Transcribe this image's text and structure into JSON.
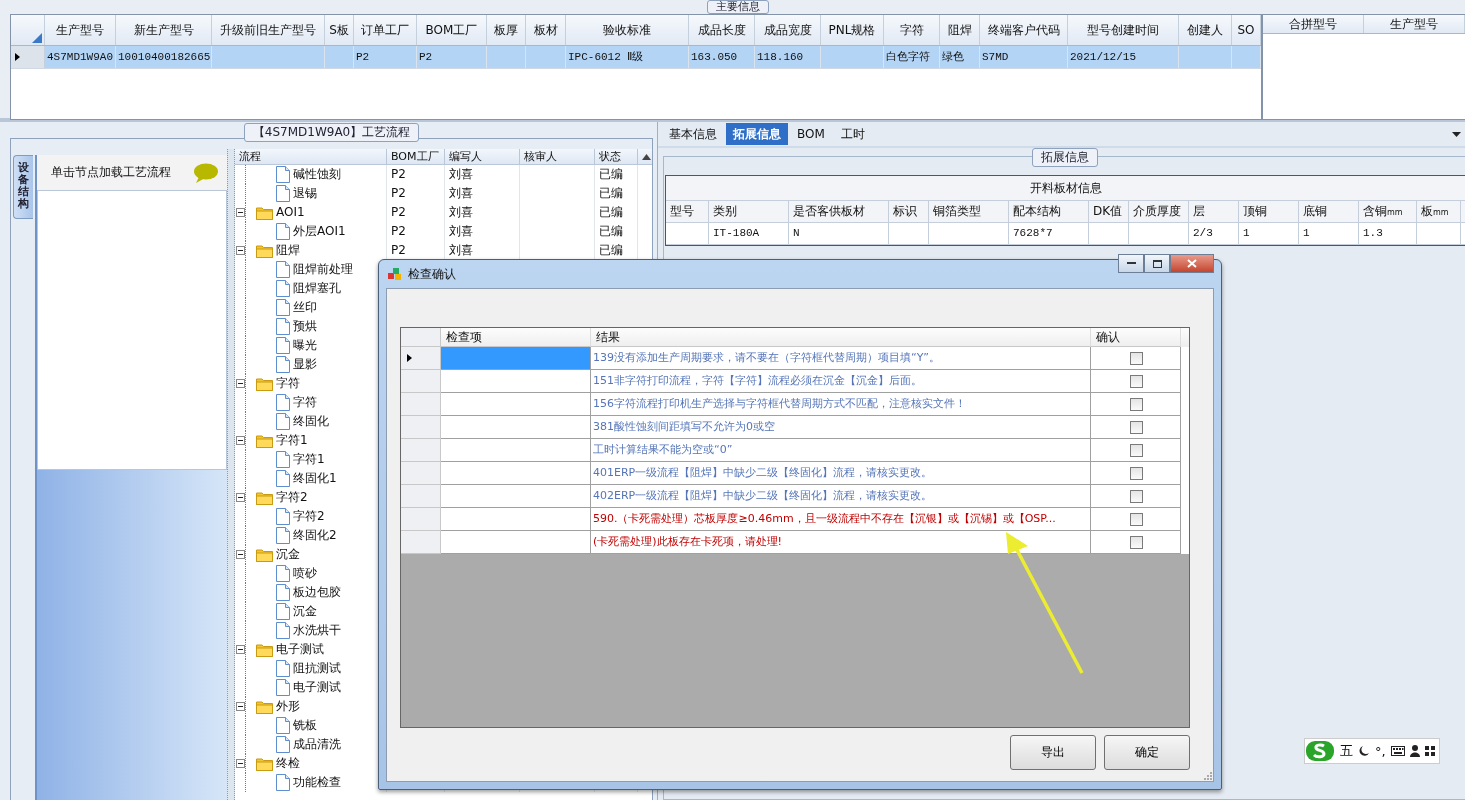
{
  "main_info": {
    "title": "主要信息",
    "columns": [
      "生产型号",
      "新生产型号",
      "升级前旧生产型号",
      "S板",
      "订单工厂",
      "BOM工厂",
      "板厚",
      "板材",
      "验收标准",
      "成品长度",
      "成品宽度",
      "PNL规格",
      "字符",
      "阻焊",
      "终端客户代码",
      "型号创建时间",
      "创建人",
      "SO"
    ],
    "rows": [
      {
        "selected": true,
        "cells": [
          "4S7MD1W9A0",
          "10010400182665",
          null,
          null,
          "P2",
          "P2",
          null,
          null,
          "IPC-6012 Ⅱ级",
          "163.050",
          "118.160",
          null,
          "白色字符",
          "绿色",
          "S7MD",
          "2021/12/15",
          null,
          null
        ]
      }
    ]
  },
  "merge_grid": {
    "columns": [
      "合拼型号",
      "生产型号"
    ]
  },
  "process": {
    "title": "【4S7MD1W9A0】工艺流程",
    "side_tab": "设备结构",
    "hint": "单击节点加载工艺流程",
    "columns": [
      "流程",
      "BOM工厂",
      "编写人",
      "核审人",
      "状态"
    ],
    "tree": [
      {
        "children": [
          {
            "kind": "file",
            "label": "碱性蚀刻",
            "cells": [
              "P2",
              "刘喜",
              null,
              "已编"
            ]
          },
          {
            "kind": "file",
            "label": "退锡",
            "cells": [
              "P2",
              "刘喜",
              null,
              "已编"
            ]
          }
        ]
      },
      {
        "kind": "folder",
        "label": "AOI1",
        "expanded": true,
        "cells": [
          "P2",
          "刘喜",
          null,
          "已编"
        ],
        "children": [
          {
            "kind": "file",
            "label": "外层AOI1",
            "cells": [
              "P2",
              "刘喜",
              null,
              "已编"
            ]
          }
        ]
      },
      {
        "kind": "folder",
        "label": "阻焊",
        "expanded": true,
        "cells": [
          "P2",
          "刘喜",
          null,
          "已编"
        ],
        "children": [
          {
            "kind": "file",
            "label": "阻焊前处理"
          },
          {
            "kind": "file",
            "label": "阻焊塞孔"
          },
          {
            "kind": "file",
            "label": "丝印"
          },
          {
            "kind": "file",
            "label": "预烘"
          },
          {
            "kind": "file",
            "label": "曝光"
          },
          {
            "kind": "file",
            "label": "显影"
          }
        ]
      },
      {
        "kind": "folder",
        "label": "字符",
        "expanded": true,
        "children": [
          {
            "kind": "file",
            "label": "字符"
          },
          {
            "kind": "file",
            "label": "终固化"
          }
        ]
      },
      {
        "kind": "folder",
        "label": "字符1",
        "expanded": true,
        "children": [
          {
            "kind": "file",
            "label": "字符1"
          },
          {
            "kind": "file",
            "label": "终固化1"
          }
        ]
      },
      {
        "kind": "folder",
        "label": "字符2",
        "expanded": true,
        "children": [
          {
            "kind": "file",
            "label": "字符2"
          },
          {
            "kind": "file",
            "label": "终固化2"
          }
        ]
      },
      {
        "kind": "folder",
        "label": "沉金",
        "expanded": true,
        "children": [
          {
            "kind": "file",
            "label": "喷砂"
          },
          {
            "kind": "file",
            "label": "板边包胶"
          },
          {
            "kind": "file",
            "label": "沉金"
          },
          {
            "kind": "file",
            "label": "水洗烘干"
          }
        ]
      },
      {
        "kind": "folder",
        "label": "电子测试",
        "expanded": true,
        "children": [
          {
            "kind": "file",
            "label": "阻抗测试"
          },
          {
            "kind": "file",
            "label": "电子测试"
          }
        ]
      },
      {
        "kind": "folder",
        "label": "外形",
        "expanded": true,
        "children": [
          {
            "kind": "file",
            "label": "铣板"
          },
          {
            "kind": "file",
            "label": "成品清洗"
          }
        ]
      },
      {
        "kind": "folder",
        "label": "终检",
        "expanded": true,
        "children": [
          {
            "kind": "file",
            "label": "功能检查"
          }
        ]
      }
    ]
  },
  "detail": {
    "tabs": [
      {
        "label": "基本信息",
        "selected": false
      },
      {
        "label": "拓展信息",
        "selected": true
      },
      {
        "label": "BOM",
        "selected": false
      },
      {
        "label": "工时",
        "selected": false
      }
    ],
    "group_title": "拓展信息",
    "table": {
      "title": "开料板材信息",
      "columns": [
        "型号",
        "类别",
        "是否客供板材",
        "标识",
        "铜箔类型",
        "配本结构",
        "DK值",
        "介质厚度",
        "层",
        "顶铜",
        "底铜",
        "含铜$_{mm}$",
        "板$_{mm}$"
      ],
      "rows": [
        [
          null,
          "IT-180A",
          "N",
          null,
          null,
          "7628*7",
          null,
          null,
          "2/3",
          "1",
          "1",
          "1.3",
          null
        ]
      ]
    }
  },
  "dialog": {
    "title": "检查确认",
    "columns": [
      "检查项",
      "结果",
      "确认"
    ],
    "rows": [
      {
        "selected": true,
        "kind": "warning",
        "checked": false,
        "result": "139没有添加生产周期要求，请不要在（字符框代替周期）项目填“Y”。"
      },
      {
        "selected": false,
        "kind": "warning",
        "checked": false,
        "result": "151非字符打印流程，字符【字符】流程必须在沉金【沉金】后面。"
      },
      {
        "selected": false,
        "kind": "warning",
        "checked": false,
        "result": "156字符流程打印机生产选择与字符框代替周期方式不匹配，注意核实文件！"
      },
      {
        "selected": false,
        "kind": "warning",
        "checked": false,
        "result": "381酸性蚀刻间距填写不允许为0或空"
      },
      {
        "selected": false,
        "kind": "warning",
        "checked": false,
        "result": "工时计算结果不能为空或“0”"
      },
      {
        "selected": false,
        "kind": "warning",
        "checked": false,
        "result": "401ERP一级流程【阻焊】中缺少二级【终固化】流程，请核实更改。"
      },
      {
        "selected": false,
        "kind": "warning",
        "checked": false,
        "result": "402ERP一级流程【阻焊】中缺少二级【终固化】流程，请核实更改。"
      },
      {
        "selected": false,
        "kind": "blocking",
        "checked": false,
        "result": "590.（卡死需处理）芯板厚度≥0.46mm，且一级流程中不存在【沉银】或【沉锡】或【OSP..."
      },
      {
        "selected": false,
        "kind": "blocking",
        "checked": false,
        "result": "(卡死需处理)此板存在卡死项，请处理!"
      }
    ],
    "buttons": [
      "导出",
      "确定"
    ]
  },
  "ime": {
    "mode": "五",
    "punctuation": "°,"
  }
}
